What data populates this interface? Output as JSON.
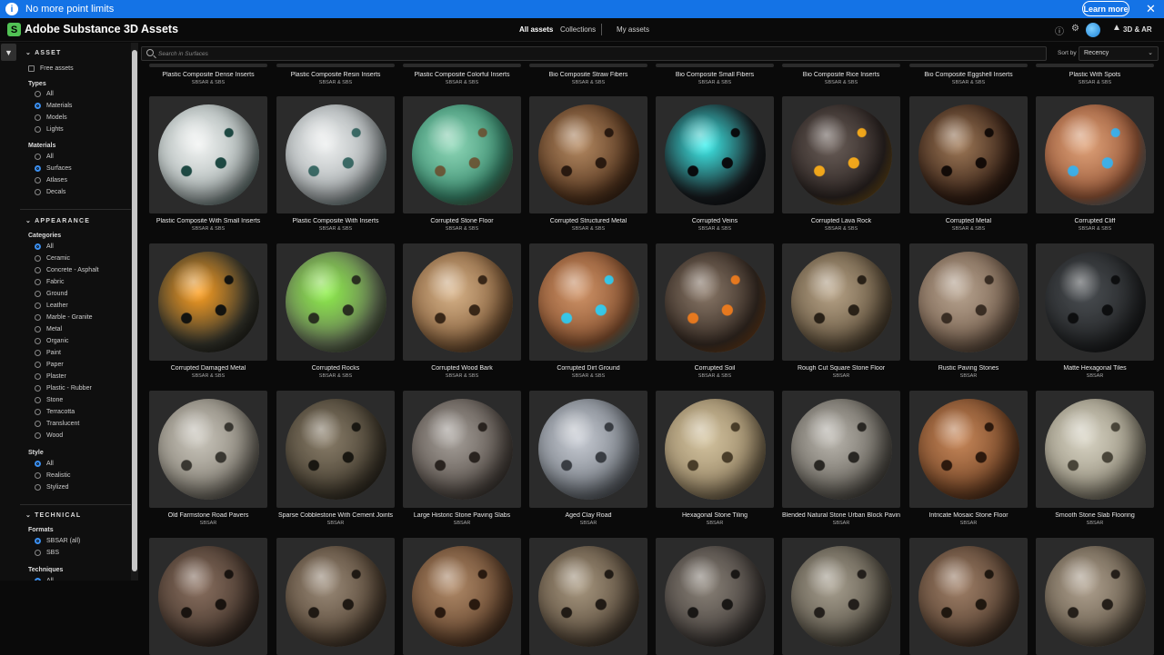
{
  "banner": {
    "text": "No more point limits",
    "learn_more": "Learn more",
    "info_icon": "info-icon",
    "close_icon": "close-icon"
  },
  "header": {
    "app_title": "Adobe Substance 3D Assets",
    "logo_letter": "S",
    "nav": [
      "All assets",
      "Collections",
      "My assets"
    ],
    "active_nav": "All assets",
    "icons": [
      "help-icon",
      "gear-icon",
      "avatar",
      "adobe-icon"
    ],
    "ar_label": "3D & AR"
  },
  "search": {
    "placeholder": "Search in Surfaces"
  },
  "sort": {
    "label": "Sort by",
    "value": "Recency"
  },
  "sidebar": {
    "asset": {
      "title": "ASSET",
      "free_assets": "Free assets",
      "types_title": "Types",
      "types": [
        {
          "label": "All",
          "on": false
        },
        {
          "label": "Materials",
          "on": true
        },
        {
          "label": "Models",
          "on": false
        },
        {
          "label": "Lights",
          "on": false
        }
      ],
      "materials_title": "Materials",
      "materials": [
        {
          "label": "All",
          "on": false
        },
        {
          "label": "Surfaces",
          "on": true
        },
        {
          "label": "Atlases",
          "on": false
        },
        {
          "label": "Decals",
          "on": false
        }
      ]
    },
    "appearance": {
      "title": "APPEARANCE",
      "categories_title": "Categories",
      "categories": [
        {
          "label": "All",
          "on": true
        },
        {
          "label": "Ceramic",
          "on": false
        },
        {
          "label": "Concrete - Asphalt",
          "on": false
        },
        {
          "label": "Fabric",
          "on": false
        },
        {
          "label": "Ground",
          "on": false
        },
        {
          "label": "Leather",
          "on": false
        },
        {
          "label": "Marble - Granite",
          "on": false
        },
        {
          "label": "Metal",
          "on": false
        },
        {
          "label": "Organic",
          "on": false
        },
        {
          "label": "Paint",
          "on": false
        },
        {
          "label": "Paper",
          "on": false
        },
        {
          "label": "Plaster",
          "on": false
        },
        {
          "label": "Plastic - Rubber",
          "on": false
        },
        {
          "label": "Stone",
          "on": false
        },
        {
          "label": "Terracotta",
          "on": false
        },
        {
          "label": "Translucent",
          "on": false
        },
        {
          "label": "Wood",
          "on": false
        }
      ],
      "style_title": "Style",
      "styles": [
        {
          "label": "All",
          "on": true
        },
        {
          "label": "Realistic",
          "on": false
        },
        {
          "label": "Stylized",
          "on": false
        }
      ]
    },
    "technical": {
      "title": "TECHNICAL",
      "formats_title": "Formats",
      "formats": [
        {
          "label": "SBSAR (all)",
          "on": true
        },
        {
          "label": "SBS",
          "on": false
        }
      ],
      "techniques_title": "Techniques",
      "techniques": [
        {
          "label": "All",
          "on": true
        }
      ]
    }
  },
  "top_row": [
    {
      "name": "Plastic Composite Dense Inserts",
      "sub": "SBSAR & SBS"
    },
    {
      "name": "Plastic Composite Resin Inserts",
      "sub": "SBSAR & SBS"
    },
    {
      "name": "Plastic Composite Colorful Inserts",
      "sub": "SBSAR & SBS"
    },
    {
      "name": "Bio Composite Straw Fibers",
      "sub": "SBSAR & SBS"
    },
    {
      "name": "Bio Composite Small Fibers",
      "sub": "SBSAR & SBS"
    },
    {
      "name": "Bio Composite Rice Inserts",
      "sub": "SBSAR & SBS"
    },
    {
      "name": "Bio Composite Eggshell Inserts",
      "sub": "SBSAR & SBS"
    },
    {
      "name": "Plastic With Spots",
      "sub": "SBSAR & SBS"
    }
  ],
  "rows": [
    [
      {
        "name": "Plastic Composite With Small Inserts",
        "sub": "SBSAR & SBS",
        "c1": "#f2f4f3",
        "c2": "#a9b3b2",
        "c3": "#1f4a44"
      },
      {
        "name": "Plastic Composite With Inserts",
        "sub": "SBSAR & SBS",
        "c1": "#eef0f0",
        "c2": "#a8aeb0",
        "c3": "#3c6a66"
      },
      {
        "name": "Corrupted Stone Floor",
        "sub": "SBSAR & SBS",
        "c1": "#8fd8b8",
        "c2": "#3d8f72",
        "c3": "#6a5a3a"
      },
      {
        "name": "Corrupted Structured Metal",
        "sub": "SBSAR & SBS",
        "c1": "#b58a62",
        "c2": "#5a3a22",
        "c3": "#2a1a10"
      },
      {
        "name": "Corrupted Veins",
        "sub": "SBSAR & SBS",
        "c1": "#3ff2f0",
        "c2": "#1a1e22",
        "c3": "#0a0c0e"
      },
      {
        "name": "Corrupted Lava Rock",
        "sub": "SBSAR & SBS",
        "c1": "#6a5e58",
        "c2": "#2e2624",
        "c3": "#f2a81c"
      },
      {
        "name": "Corrupted Metal",
        "sub": "SBSAR & SBS",
        "c1": "#a07a58",
        "c2": "#3a2418",
        "c3": "#140c08"
      },
      {
        "name": "Corrupted Cliff",
        "sub": "SBSAR & SBS",
        "c1": "#e0a37a",
        "c2": "#9a5a3a",
        "c3": "#3fb0e8"
      }
    ],
    [
      {
        "name": "Corrupted Damaged Metal",
        "sub": "SBSAR & SBS",
        "c1": "#ffa020",
        "c2": "#3a3a30",
        "c3": "#141410"
      },
      {
        "name": "Corrupted Rocks",
        "sub": "SBSAR & SBS",
        "c1": "#8ef04a",
        "c2": "#6a7a5a",
        "c3": "#2a3020"
      },
      {
        "name": "Corrupted Wood Bark",
        "sub": "SBSAR & SBS",
        "c1": "#d8b48a",
        "c2": "#8a6440",
        "c3": "#3a2818"
      },
      {
        "name": "Corrupted Dirt Ground",
        "sub": "SBSAR & SBS",
        "c1": "#d09468",
        "c2": "#8a5432",
        "c3": "#38c8e8"
      },
      {
        "name": "Corrupted Soil",
        "sub": "SBSAR & SBS",
        "c1": "#8a7868",
        "c2": "#3a2e26",
        "c3": "#e87a20"
      },
      {
        "name": "Rough Cut Square Stone Floor",
        "sub": "SBSAR",
        "c1": "#b8a488",
        "c2": "#6a5a44",
        "c3": "#2a2218"
      },
      {
        "name": "Rustic Paving Stones",
        "sub": "SBSAR",
        "c1": "#b8a490",
        "c2": "#7a6452",
        "c3": "#3a2e24"
      },
      {
        "name": "Matte Hexagonal Tiles",
        "sub": "SBSAR",
        "c1": "#4a4e52",
        "c2": "#26282a",
        "c3": "#0e0f10"
      }
    ],
    [
      {
        "name": "Old Farmstone Road Pavers",
        "sub": "SBSAR",
        "c1": "#cac6bc",
        "c2": "#8a857a",
        "c3": "#3a3832"
      },
      {
        "name": "Sparse Cobblestone With Cement Joints",
        "sub": "SBSAR",
        "c1": "#8a7e6a",
        "c2": "#4a4234",
        "c3": "#1a1812"
      },
      {
        "name": "Large Historic Stone Paving Slabs",
        "sub": "SBSAR",
        "c1": "#a6a09a",
        "c2": "#5e5650",
        "c3": "#2a2420"
      },
      {
        "name": "Aged Clay Road",
        "sub": "SBSAR",
        "c1": "#c8ccd4",
        "c2": "#7a8088",
        "c3": "#3a3e44"
      },
      {
        "name": "Hexagonal Stone Tiling",
        "sub": "SBSAR",
        "c1": "#d4c4a0",
        "c2": "#9a8868",
        "c3": "#4a3e2a"
      },
      {
        "name": "Blended Natural Stone Urban Block Paving",
        "sub": "SBSAR",
        "c1": "#bab6ae",
        "c2": "#6e6a62",
        "c3": "#2a2824"
      },
      {
        "name": "Intricate Mosaic Stone Floor",
        "sub": "SBSAR",
        "c1": "#c8885a",
        "c2": "#7a4a2a",
        "c3": "#2e1a0e"
      },
      {
        "name": "Smooth Stone Slab Flooring",
        "sub": "SBSAR",
        "c1": "#d8d4c4",
        "c2": "#9a9482",
        "c3": "#4a463a"
      }
    ],
    [
      {
        "name": "",
        "sub": "",
        "c1": "#8a7060",
        "c2": "#4a3a30",
        "c3": "#1a1410"
      },
      {
        "name": "",
        "sub": "",
        "c1": "#9a8a78",
        "c2": "#5a4a3a",
        "c3": "#201a14"
      },
      {
        "name": "",
        "sub": "",
        "c1": "#b08a68",
        "c2": "#6a4a32",
        "c3": "#2a1a10"
      },
      {
        "name": "",
        "sub": "",
        "c1": "#a89880",
        "c2": "#5e5040",
        "c3": "#221c16"
      },
      {
        "name": "",
        "sub": "",
        "c1": "#8a8278",
        "c2": "#4a4440",
        "c3": "#1a1816"
      },
      {
        "name": "",
        "sub": "",
        "c1": "#a8a090",
        "c2": "#5e584c",
        "c3": "#24201c"
      },
      {
        "name": "",
        "sub": "",
        "c1": "#a08068",
        "c2": "#5a4434",
        "c3": "#201810"
      },
      {
        "name": "",
        "sub": "",
        "c1": "#b0a290",
        "c2": "#6a5e4e",
        "c3": "#26201a"
      }
    ]
  ]
}
